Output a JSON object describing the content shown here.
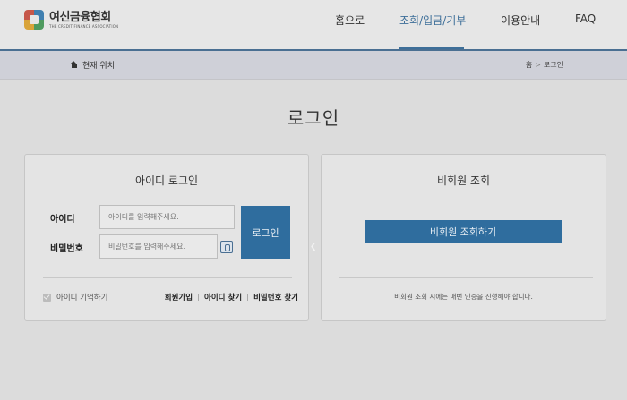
{
  "header": {
    "logo_name": "여신금융협회",
    "logo_sub": "THE CREDIT FINANCE ASSOCIATION",
    "nav": [
      "홈으로",
      "조회/입금/기부",
      "이용안내",
      "FAQ"
    ],
    "active_color": "#3e6f99"
  },
  "breadcrumb": {
    "current_label": "현재 위치",
    "path": [
      "홈",
      "로그인"
    ]
  },
  "page_title": "로그인",
  "login": {
    "title": "아이디 로그인",
    "id_label": "아이디",
    "id_placeholder": "아이디를 입력해주세요.",
    "pw_label": "비밀번호",
    "pw_placeholder": "비밀번호를 입력해주세요.",
    "login_button": "로그인",
    "remember_label": "아이디 기억하기",
    "links": [
      "회원가입",
      "아이디 찾기",
      "비밀번호 찾기"
    ]
  },
  "nonmember": {
    "title": "비회원 조회",
    "button": "비회원 조회하기",
    "notice": "비회원 조회 시에는 매번 인증을 진행해야 합니다."
  },
  "colors": {
    "primary_button": "#2f6d9e",
    "overlay_background": "#dcdcdc"
  }
}
